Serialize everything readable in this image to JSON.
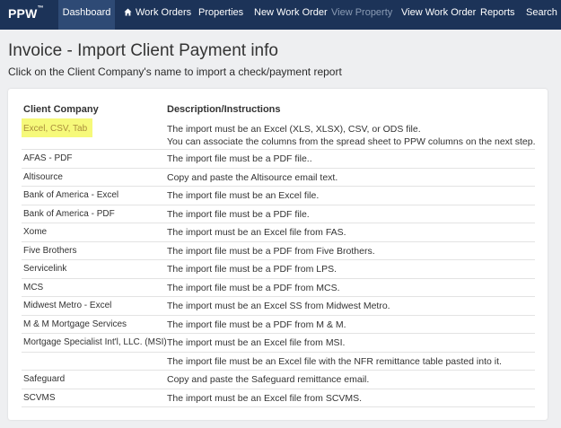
{
  "nav": {
    "brand": "PPW",
    "brand_tm": "™",
    "items": [
      {
        "label": "Dashboard",
        "active": true
      },
      {
        "label": "Work Orders",
        "icon": "home-icon"
      },
      {
        "label": "Properties"
      },
      {
        "label": "New Work Order"
      },
      {
        "label": "View Property",
        "disabled": true
      },
      {
        "label": "View Work Order"
      },
      {
        "label": "Reports"
      },
      {
        "label": "Search"
      }
    ]
  },
  "page": {
    "title": "Invoice - Import Client Payment info",
    "subtitle": "Click on the Client Company's name to import a check/payment report"
  },
  "table": {
    "headers": {
      "company": "Client Company",
      "description": "Description/Instructions"
    },
    "rows": [
      {
        "company": "Excel, CSV, Tab",
        "description": [
          "The import must be an Excel (XLS, XLSX), CSV, or ODS file.",
          "You can associate the columns from the spread sheet to PPW columns on the next step."
        ],
        "highlighted": true
      },
      {
        "company": "AFAS - PDF",
        "description": [
          "The import file must be a PDF file.."
        ]
      },
      {
        "company": "Altisource",
        "description": [
          "Copy and paste the Altisource email text."
        ]
      },
      {
        "company": "Bank of America - Excel",
        "description": [
          "The import file must be an Excel file."
        ]
      },
      {
        "company": "Bank of America - PDF",
        "description": [
          "The import file must be a PDF file."
        ]
      },
      {
        "company": "Xome",
        "description": [
          "The import must be an Excel file from FAS."
        ]
      },
      {
        "company": "Five Brothers",
        "description": [
          "The import file must be a PDF from Five Brothers."
        ]
      },
      {
        "company": "Servicelink",
        "description": [
          "The import file must be a PDF from LPS."
        ]
      },
      {
        "company": "MCS",
        "description": [
          "The import file must be a PDF from MCS."
        ]
      },
      {
        "company": "Midwest Metro - Excel",
        "description": [
          "The import must be an Excel SS from Midwest Metro."
        ]
      },
      {
        "company": "M & M Mortgage Services",
        "description": [
          "The import file must be a PDF from M & M."
        ]
      },
      {
        "company": "Mortgage Specialist Int'l, LLC. (MSI)",
        "description": [
          "The import must be an Excel file from MSI."
        ]
      },
      {
        "company": "",
        "description": [
          "The import file must be an Excel file with the NFR remittance table pasted into it."
        ]
      },
      {
        "company": "Safeguard",
        "description": [
          "Copy and paste the Safeguard remittance email."
        ]
      },
      {
        "company": "SCVMS",
        "description": [
          "The import must be an Excel file from SCVMS."
        ]
      }
    ]
  },
  "colors": {
    "navbar": "#1c3358",
    "navbar_active": "#2e4a75",
    "highlight": "#f6f97a",
    "highlight_text": "#aa8e3c"
  }
}
